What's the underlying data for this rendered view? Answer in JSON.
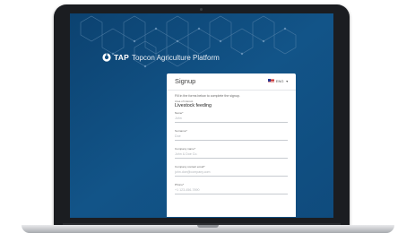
{
  "brand": {
    "short": "TAP",
    "name": "Topcon Agriculture Platform"
  },
  "signup": {
    "title": "Signup",
    "language": "ENG",
    "instructions": "Fill in the forms below to complete the signup.",
    "area_of_interest": {
      "label": "Area of interest",
      "value": "Livestock feeding"
    },
    "fields": [
      {
        "label": "Name*",
        "placeholder": "John"
      },
      {
        "label": "Surname*",
        "placeholder": "Doe"
      },
      {
        "label": "Company name*",
        "placeholder": "John & Doe Co."
      },
      {
        "label": "Company contact email*",
        "placeholder": "john.doe@company.com"
      },
      {
        "label": "Phone*",
        "placeholder": "+1 123-456-7890"
      }
    ]
  },
  "colors": {
    "screen_background": "#0f4d80",
    "card_background": "#ffffff",
    "laptop_frame": "#1b1d21"
  },
  "icons": {
    "logo": "tap-logo-icon",
    "flag": "us-flag-icon",
    "dropdown": "chevron-down-icon"
  }
}
